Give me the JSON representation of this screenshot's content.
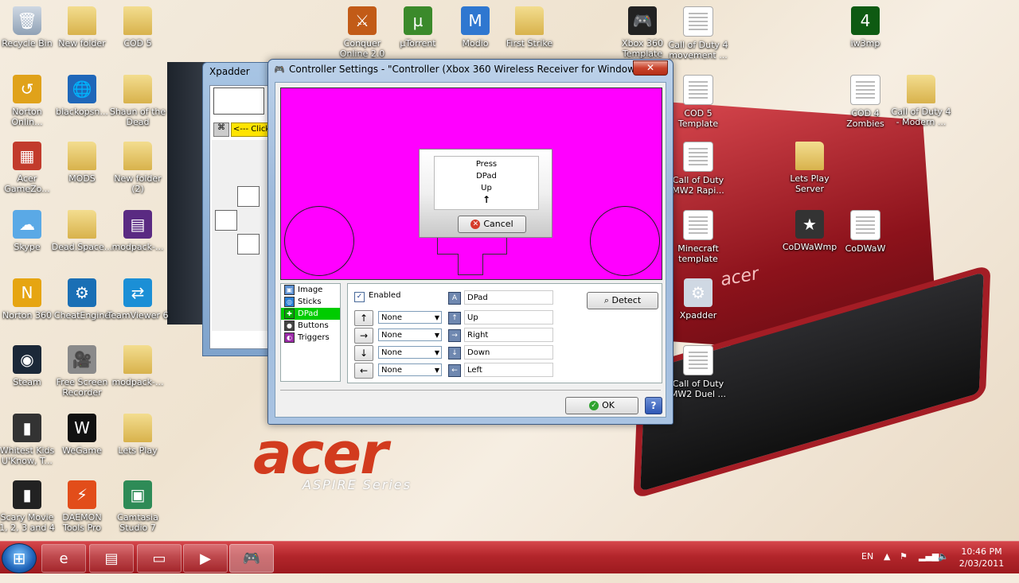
{
  "desktop": {
    "icons": [
      {
        "label": "Recycle Bin",
        "glyph": "🗑"
      },
      {
        "label": "New folder"
      },
      {
        "label": "COD 5"
      },
      {
        "label": "Conquer Online 2.0",
        "glyph": "⚔"
      },
      {
        "label": "µTorrent",
        "glyph": "µ"
      },
      {
        "label": "Modio",
        "glyph": "M"
      },
      {
        "label": "First Strike"
      },
      {
        "label": "Xbox 360 Template",
        "glyph": "🎮"
      },
      {
        "label": "Call of Duty 4 movement ..."
      },
      {
        "label": "iw3mp",
        "glyph": "4"
      },
      {
        "label": "Norton Onlin...",
        "glyph": "↺"
      },
      {
        "label": "blackopsn...",
        "glyph": "🌐"
      },
      {
        "label": "Shaun of the Dead"
      },
      {
        "label": "COD 5 Template"
      },
      {
        "label": "COD 4 Zombies"
      },
      {
        "label": "Call of Duty 4 - Modern ..."
      },
      {
        "label": "Acer GameZo...",
        "glyph": "▦"
      },
      {
        "label": "MODS"
      },
      {
        "label": "New folder (2)"
      },
      {
        "label": "Call of Duty MW2 Rapi..."
      },
      {
        "label": "Lets Play Server"
      },
      {
        "label": "Skype",
        "glyph": "☁"
      },
      {
        "label": "Dead.Space..."
      },
      {
        "label": "modpack-...",
        "glyph": "▤"
      },
      {
        "label": "Minecraft template"
      },
      {
        "label": "CoDWaWmp",
        "glyph": "★"
      },
      {
        "label": "CoDWaW",
        "glyph": "W"
      },
      {
        "label": "Norton 360",
        "glyph": "N"
      },
      {
        "label": "CheatEngine",
        "glyph": "⚙"
      },
      {
        "label": "TeamViewer 6",
        "glyph": "⇄"
      },
      {
        "label": "Xpadder",
        "glyph": "⚙"
      },
      {
        "label": "Steam",
        "glyph": "◉"
      },
      {
        "label": "Free Screen Recorder",
        "glyph": "🎥"
      },
      {
        "label": "modpack-..."
      },
      {
        "label": "Call of Duty MW2 Duel ..."
      },
      {
        "label": "Whitest Kids U'Know, T...",
        "glyph": "▮"
      },
      {
        "label": "WeGame",
        "glyph": "W"
      },
      {
        "label": "Lets Play"
      },
      {
        "label": "Scary Movie 1, 2, 3 and 4",
        "glyph": "▮"
      },
      {
        "label": "DAEMON Tools Pro",
        "glyph": "⚡"
      },
      {
        "label": "Camtasia Studio 7",
        "glyph": "▣"
      }
    ],
    "wallpaper": {
      "brand": "acer",
      "series": "ASPIRE Series",
      "lid_brand": "acer"
    }
  },
  "xpadder": {
    "title": "Xpadder",
    "click_label": "<--- Click"
  },
  "dialog": {
    "title": "Controller Settings - \"Controller (Xbox 360 Wireless Receiver for Windows)\"",
    "close_label": "✕",
    "prompt": {
      "line1": "Press",
      "line2": "DPad",
      "line3": "Up",
      "arrow": "↑"
    },
    "cancel_label": "Cancel",
    "categories": [
      {
        "label": "Image",
        "selected": false
      },
      {
        "label": "Sticks",
        "selected": false
      },
      {
        "label": "DPad",
        "selected": true
      },
      {
        "label": "Buttons",
        "selected": false
      },
      {
        "label": "Triggers",
        "selected": false
      }
    ],
    "enabled_label": "Enabled",
    "enabled_checked": true,
    "name_field": "DPad",
    "detect_label": "Detect",
    "directions": [
      {
        "arrow": "↑",
        "select": "None",
        "field": "Up"
      },
      {
        "arrow": "→",
        "select": "None",
        "field": "Right"
      },
      {
        "arrow": "↓",
        "select": "None",
        "field": "Down"
      },
      {
        "arrow": "←",
        "select": "None",
        "field": "Left"
      }
    ],
    "ok_label": "OK",
    "help_label": "?"
  },
  "taskbar": {
    "language": "EN",
    "time": "10:46 PM",
    "date": "2/03/2011"
  },
  "colors": {
    "preview_bg": "#ff00ff",
    "taskbar": "#b3262b",
    "selected_category": "#00cc00"
  }
}
